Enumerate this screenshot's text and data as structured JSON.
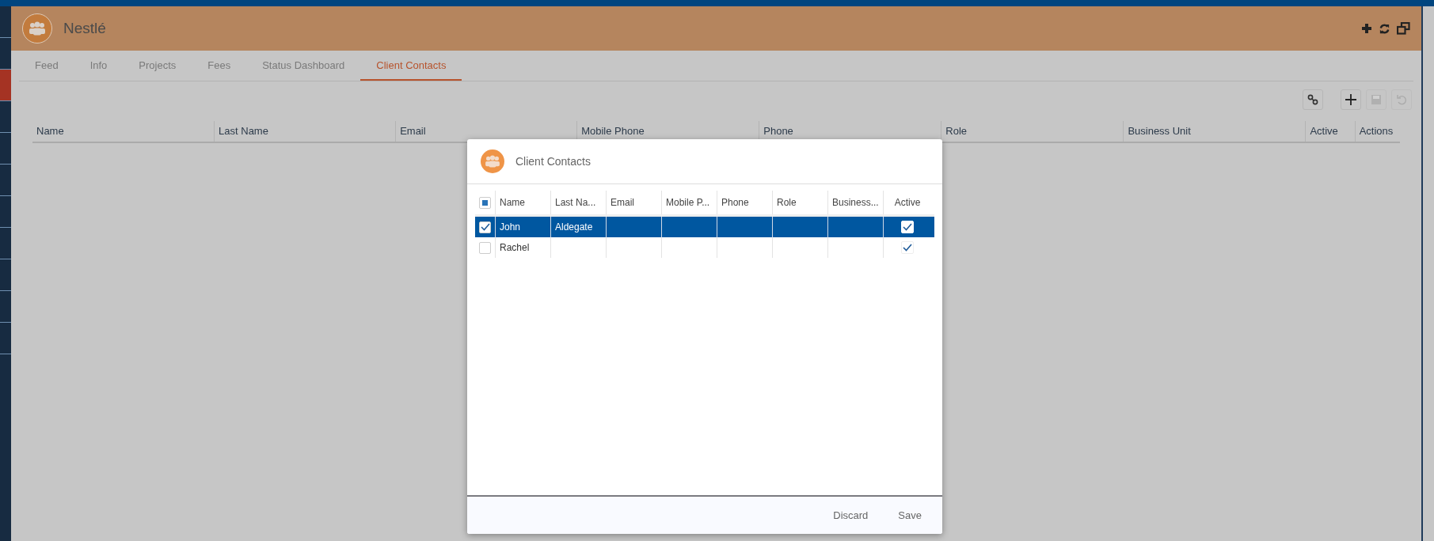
{
  "sidebar": {
    "items": [
      {
        "selected": false
      },
      {
        "selected": false
      },
      {
        "selected": true
      },
      {
        "selected": false
      },
      {
        "selected": false
      },
      {
        "selected": false
      },
      {
        "selected": false
      },
      {
        "selected": false
      },
      {
        "selected": false
      },
      {
        "selected": false
      },
      {
        "selected": false
      }
    ]
  },
  "header": {
    "title": "Nestlé"
  },
  "tabs": [
    {
      "label": "Feed",
      "selected": false
    },
    {
      "label": "Info",
      "selected": false
    },
    {
      "label": "Projects",
      "selected": false
    },
    {
      "label": "Fees",
      "selected": false
    },
    {
      "label": "Status Dashboard",
      "selected": false
    },
    {
      "label": "Client Contacts",
      "selected": true
    }
  ],
  "toolbar": [
    {
      "kind": "link",
      "disabled": false
    },
    {
      "kind": "add",
      "disabled": false
    },
    {
      "kind": "save",
      "disabled": true
    },
    {
      "kind": "undo",
      "disabled": true
    }
  ],
  "table": {
    "columns": [
      "Name",
      "Last Name",
      "Email",
      "Mobile Phone",
      "Phone",
      "Role",
      "Business Unit",
      "Active",
      "Actions"
    ]
  },
  "dialog": {
    "title": "Client Contacts",
    "select_all": {
      "indeterminate": true
    },
    "columns": [
      "Name",
      "Last Na...",
      "Email",
      "Mobile P...",
      "Phone",
      "Role",
      "Business...",
      "Active"
    ],
    "rows": [
      {
        "selected": true,
        "checked": true,
        "name": "John",
        "last_name": "Aldegate",
        "active": true
      },
      {
        "selected": false,
        "checked": false,
        "name": "Rachel",
        "last_name": "",
        "active": true
      }
    ],
    "buttons": [
      "Discard",
      "Save"
    ]
  }
}
